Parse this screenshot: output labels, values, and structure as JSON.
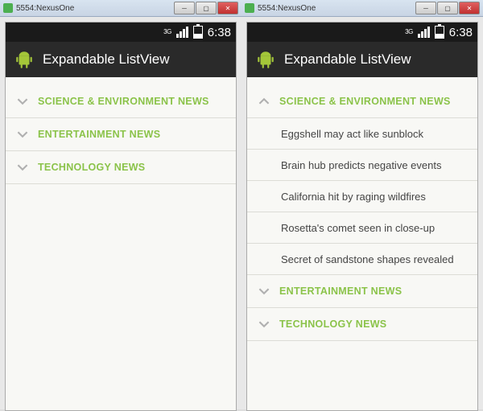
{
  "window_title": "5554:NexusOne",
  "status": {
    "network_label": "3G",
    "time": "6:38"
  },
  "app": {
    "title": "Expandable ListView"
  },
  "left": {
    "groups": [
      {
        "expanded": false,
        "label": "SCIENCE & ENVIRONMENT NEWS",
        "children": []
      },
      {
        "expanded": false,
        "label": "ENTERTAINMENT NEWS",
        "children": []
      },
      {
        "expanded": false,
        "label": "TECHNOLOGY NEWS",
        "children": []
      }
    ]
  },
  "right": {
    "groups": [
      {
        "expanded": true,
        "label": "SCIENCE & ENVIRONMENT NEWS",
        "children": [
          "Eggshell may act like sunblock",
          "Brain hub predicts negative events",
          "California hit by raging wildfires",
          "Rosetta's comet seen in close-up",
          "Secret of sandstone shapes revealed"
        ]
      },
      {
        "expanded": false,
        "label": "ENTERTAINMENT NEWS",
        "children": []
      },
      {
        "expanded": false,
        "label": "TECHNOLOGY NEWS",
        "children": []
      }
    ]
  }
}
